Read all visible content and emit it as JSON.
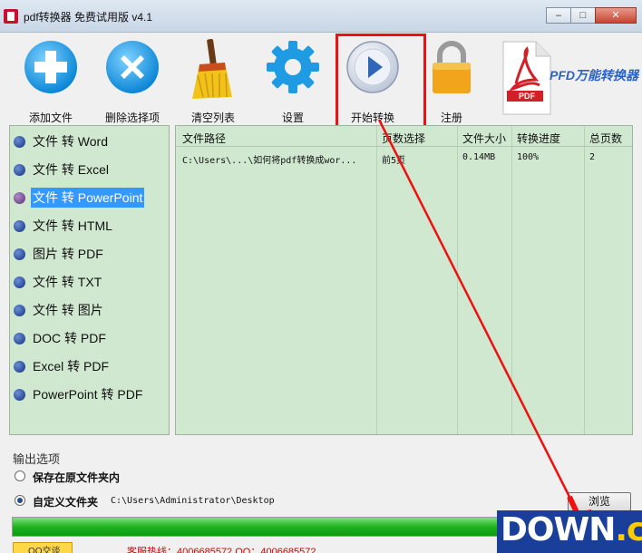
{
  "window": {
    "title": "pdf转换器 免费试用版 v4.1",
    "minimize": "–",
    "maximize": "□",
    "close": "✕"
  },
  "toolbar": {
    "add_file": "添加文件",
    "remove_selected": "删除选择项",
    "clear_list": "清空列表",
    "settings": "设置",
    "start_convert": "开始转换",
    "register": "注册"
  },
  "brand": {
    "text": "PFD万能转换器",
    "logo_label": "PDF",
    "colors": {
      "accent": "#e11"
    }
  },
  "sidebar": {
    "items": [
      {
        "label": "文件 转 Word"
      },
      {
        "label": "文件 转 Excel"
      },
      {
        "label": "文件 转 PowerPoint",
        "selected": true
      },
      {
        "label": "文件 转 HTML"
      },
      {
        "label": "图片 转 PDF"
      },
      {
        "label": "文件 转 TXT"
      },
      {
        "label": "文件 转 图片"
      },
      {
        "label": "DOC 转 PDF"
      },
      {
        "label": "Excel 转 PDF"
      },
      {
        "label": "PowerPoint 转 PDF"
      }
    ]
  },
  "table": {
    "columns": [
      "文件路径",
      "页数选择",
      "文件大小",
      "转换进度",
      "总页数"
    ],
    "rows": [
      [
        "C:\\Users\\...\\如何将pdf转换成wor...",
        "前5页",
        "0.14MB",
        "100%",
        "2"
      ]
    ]
  },
  "output": {
    "title": "输出选项",
    "option_original": "保存在原文件夹内",
    "option_custom": "自定义文件夹",
    "custom_selected": true,
    "path": "C:\\Users\\Administrator\\Desktop",
    "browse": "浏览"
  },
  "progress": {
    "fraction": 0.82
  },
  "status": {
    "qq": "QQ交谈",
    "contact": "客服热线：4006685572 QQ：4006685572"
  },
  "watermark": {
    "main": "DOWN",
    "suffix": ".cc"
  }
}
